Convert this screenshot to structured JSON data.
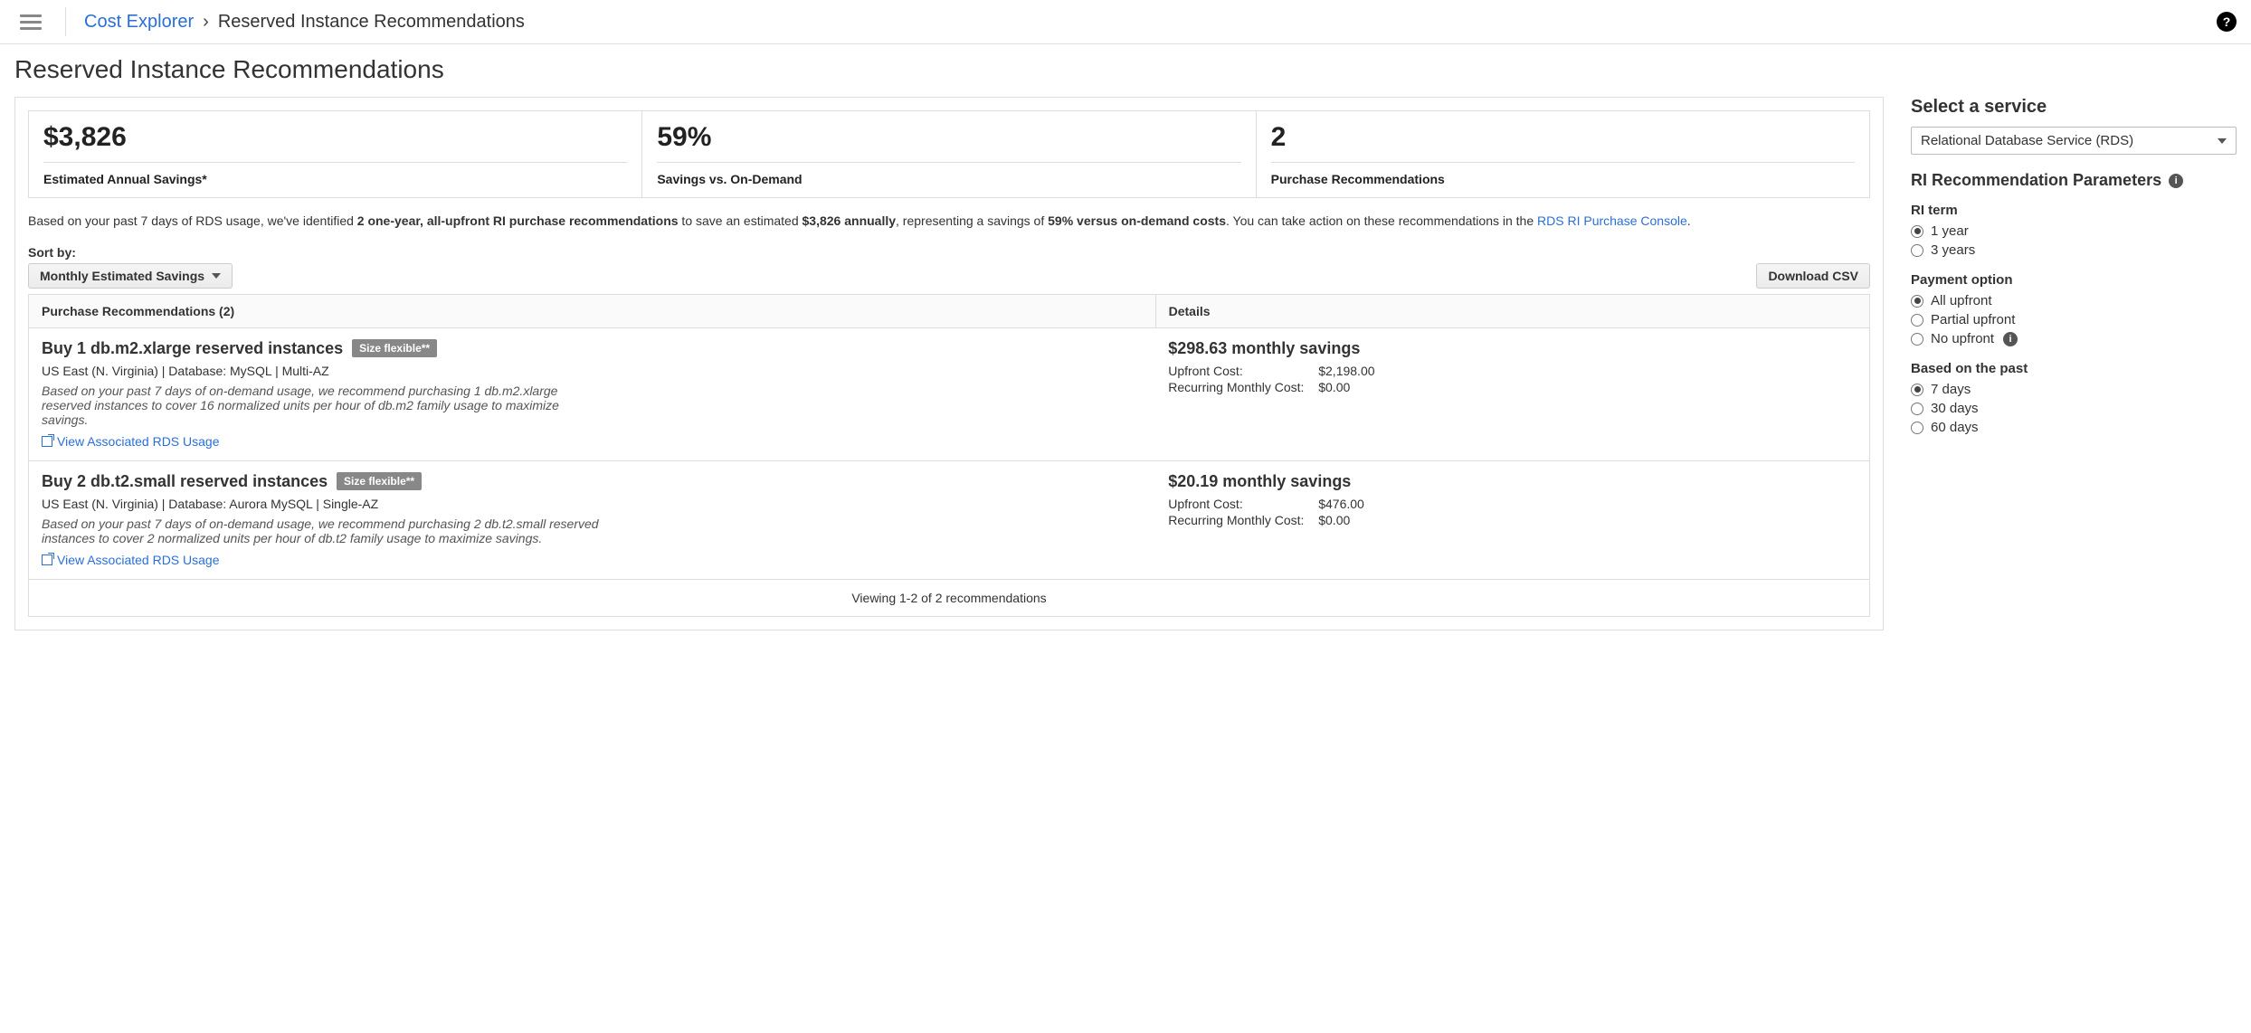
{
  "breadcrumb": {
    "root": "Cost Explorer",
    "current": "Reserved Instance Recommendations"
  },
  "page_title": "Reserved Instance Recommendations",
  "stats": {
    "savings_value": "$3,826",
    "savings_label": "Estimated Annual Savings*",
    "pct_value": "59%",
    "pct_label": "Savings vs. On-Demand",
    "count_value": "2",
    "count_label": "Purchase Recommendations"
  },
  "intro": {
    "pre": "Based on your past 7 days of RDS usage, we've identified ",
    "bold1": "2 one-year, all-upfront RI purchase recommendations",
    "mid1": " to save an estimated ",
    "bold2": "$3,826 annually",
    "mid2": ", representing a savings of ",
    "bold3": "59% versus on-demand costs",
    "mid3": ". You can take action on these recommendations in the ",
    "link": "RDS RI Purchase Console",
    "post": "."
  },
  "toolbar": {
    "sort_label": "Sort by:",
    "sort_value": "Monthly Estimated Savings",
    "download": "Download CSV"
  },
  "table": {
    "header_left": "Purchase Recommendations (2)",
    "header_right": "Details",
    "badge": "Size flexible**",
    "upfront_label": "Upfront Cost:",
    "recurring_label": "Recurring Monthly Cost:",
    "view_link": "View Associated RDS Usage",
    "footer": "Viewing 1-2 of 2 recommendations"
  },
  "recs": [
    {
      "title": "Buy 1 db.m2.xlarge reserved instances",
      "sub": "US East (N. Virginia) | Database: MySQL | Multi-AZ",
      "desc": "Based on your past 7 days of on-demand usage, we recommend purchasing 1 db.m2.xlarge reserved instances to cover 16 normalized units per hour of db.m2 family usage to maximize savings.",
      "monthly": "$298.63 monthly savings",
      "upfront": "$2,198.00",
      "recurring": "$0.00"
    },
    {
      "title": "Buy 2 db.t2.small reserved instances",
      "sub": "US East (N. Virginia) | Database: Aurora MySQL | Single-AZ",
      "desc": "Based on your past 7 days of on-demand usage, we recommend purchasing 2 db.t2.small reserved instances to cover 2 normalized units per hour of db.t2 family usage to maximize savings.",
      "monthly": "$20.19 monthly savings",
      "upfront": "$476.00",
      "recurring": "$0.00"
    }
  ],
  "sidebar": {
    "service_heading": "Select a service",
    "service_selected": "Relational Database Service (RDS)",
    "params_heading": "RI Recommendation Parameters",
    "term": {
      "title": "RI term",
      "o1": "1 year",
      "o2": "3 years"
    },
    "payment": {
      "title": "Payment option",
      "o1": "All upfront",
      "o2": "Partial upfront",
      "o3": "No upfront"
    },
    "past": {
      "title": "Based on the past",
      "o1": "7 days",
      "o2": "30 days",
      "o3": "60 days"
    }
  }
}
